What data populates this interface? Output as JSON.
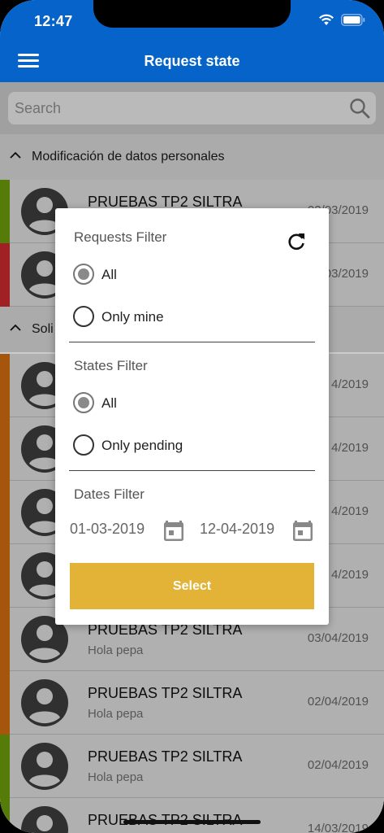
{
  "status": {
    "time": "12:47"
  },
  "header": {
    "title": "Request state"
  },
  "search": {
    "placeholder": "Search"
  },
  "sections": [
    {
      "label": "Modificación de datos personales"
    },
    {
      "label": "Soli"
    }
  ],
  "rows": [
    {
      "name": "PRUEBAS TP2 SILTRA",
      "sub": "",
      "date": "02/03/2019",
      "stripe": "#6b9a0c"
    },
    {
      "name": "",
      "sub": "",
      "date": "03/2019",
      "stripe": "#c8282c"
    },
    {
      "name": "",
      "sub": "",
      "date": "4/2019",
      "stripe": "#d06b10"
    },
    {
      "name": "",
      "sub": "",
      "date": "4/2019",
      "stripe": "#d06b10"
    },
    {
      "name": "",
      "sub": "",
      "date": "4/2019",
      "stripe": "#d06b10"
    },
    {
      "name": "",
      "sub": "",
      "date": "4/2019",
      "stripe": "#d06b10"
    },
    {
      "name": "PRUEBAS TP2 SILTRA",
      "sub": "Hola pepa",
      "date": "03/04/2019",
      "stripe": "#d06b10"
    },
    {
      "name": "PRUEBAS TP2 SILTRA",
      "sub": "Hola pepa",
      "date": "02/04/2019",
      "stripe": "#d06b10"
    },
    {
      "name": "PRUEBAS TP2 SILTRA",
      "sub": "Hola pepa",
      "date": "02/04/2019",
      "stripe": "#6b9a0c"
    },
    {
      "name": "PRUEBAS TP2 SILTRA",
      "sub": "",
      "date": "14/03/2019",
      "stripe": "#6b9a0c"
    }
  ],
  "dialog": {
    "requests_filter": {
      "title": "Requests Filter",
      "options": [
        {
          "label": "All",
          "selected": true
        },
        {
          "label": "Only mine",
          "selected": false
        }
      ]
    },
    "states_filter": {
      "title": "States Filter",
      "options": [
        {
          "label": "All",
          "selected": true
        },
        {
          "label": "Only pending",
          "selected": false
        }
      ]
    },
    "dates_filter": {
      "title": "Dates Filter",
      "from": "01-03-2019",
      "to": "12-04-2019"
    },
    "select_label": "Select"
  },
  "colors": {
    "header": "#0563c9",
    "select_button": "#e2b336"
  }
}
